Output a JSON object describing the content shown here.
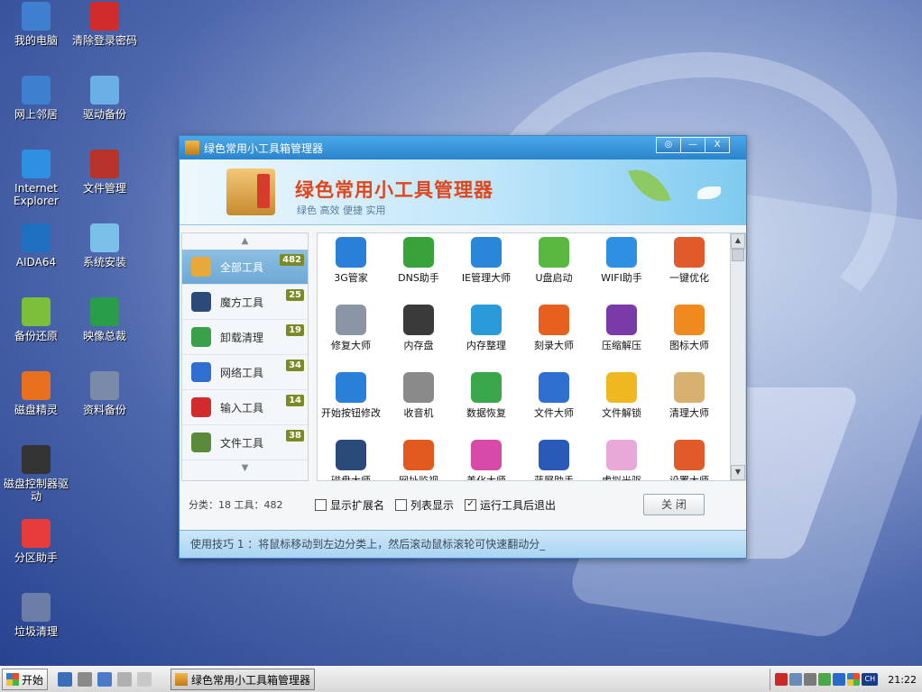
{
  "desktop": {
    "icons": [
      {
        "label": "我的电脑",
        "icon": "computer-icon",
        "color": "#3f7fd0"
      },
      {
        "label": "清除登录密码",
        "icon": "nt-key-icon",
        "color": "#d22b2b"
      },
      {
        "label": "网上邻居",
        "icon": "network-icon",
        "color": "#3f7fd0"
      },
      {
        "label": "驱动备份",
        "icon": "driver-backup-icon",
        "color": "#6ab0e6"
      },
      {
        "label": "Internet Explorer",
        "icon": "ie-icon",
        "color": "#2f8fe0"
      },
      {
        "label": "文件管理",
        "icon": "file-manager-icon",
        "color": "#b8342a"
      },
      {
        "label": "AIDA64",
        "icon": "aida64-icon",
        "color": "#1e6fc0"
      },
      {
        "label": "系统安装",
        "icon": "system-install-icon",
        "color": "#7bc0e8"
      },
      {
        "label": "备份还原",
        "icon": "backup-restore-icon",
        "color": "#7bbf3a"
      },
      {
        "label": "映像总裁",
        "icon": "image-president-icon",
        "color": "#2a9d4a"
      },
      {
        "label": "磁盘精灵",
        "icon": "diskgenius-icon",
        "color": "#e8701e"
      },
      {
        "label": "资料备份",
        "icon": "data-backup-icon",
        "color": "#7a8aa8"
      },
      {
        "label": "磁盘控制器驱动",
        "icon": "disk-controller-icon",
        "color": "#333333"
      },
      {
        "label": "分区助手",
        "icon": "partition-icon",
        "color": "#e83b3b"
      },
      {
        "label": "垃圾清理",
        "icon": "cleanup-icon",
        "color": "#6a7ea8"
      }
    ]
  },
  "window": {
    "title": "绿色常用小工具箱管理器",
    "buttons": {
      "help": "◎",
      "minimize": "—",
      "close": "X"
    },
    "banner": {
      "title": "绿色常用小工具管理器",
      "subtitle": "绿色 高效 便捷 实用"
    },
    "sidebar": {
      "up_arrow": "▲",
      "down_arrow": "▼",
      "categories": [
        {
          "label": "全部工具",
          "count": "482",
          "icon": "all-tools-icon",
          "color": "#e9a93a"
        },
        {
          "label": "魔方工具",
          "count": "25",
          "icon": "magic-cube-icon",
          "color": "#2b4a7a"
        },
        {
          "label": "卸载清理",
          "count": "19",
          "icon": "uninstall-icon",
          "color": "#3aa04a"
        },
        {
          "label": "网络工具",
          "count": "34",
          "icon": "globe-icon",
          "color": "#2f6fcf"
        },
        {
          "label": "输入工具",
          "count": "14",
          "icon": "input-icon",
          "color": "#d22b2b"
        },
        {
          "label": "文件工具",
          "count": "38",
          "icon": "file-tools-icon",
          "color": "#5a8a3a"
        }
      ]
    },
    "tools": [
      {
        "label": "3G管家",
        "icon": "3g-icon",
        "color": "#2a7fd8"
      },
      {
        "label": "DNS助手",
        "icon": "dns-icon",
        "color": "#3aa23a"
      },
      {
        "label": "IE管理大师",
        "icon": "ie-manager-icon",
        "color": "#2a86d8"
      },
      {
        "label": "U盘启动",
        "icon": "usb-boot-icon",
        "color": "#58b840"
      },
      {
        "label": "WIFI助手",
        "icon": "wifi-icon",
        "color": "#2f8fe0"
      },
      {
        "label": "一键优化",
        "icon": "rocket-icon",
        "color": "#e05a2a"
      },
      {
        "label": "修复大师",
        "icon": "wrench-icon",
        "color": "#8a96a6"
      },
      {
        "label": "内存盘",
        "icon": "ramdisk-icon",
        "color": "#3a3a3a"
      },
      {
        "label": "内存整理",
        "icon": "memory-icon",
        "color": "#2a9ad8"
      },
      {
        "label": "刻录大师",
        "icon": "burn-icon",
        "color": "#e8601e"
      },
      {
        "label": "压缩解压",
        "icon": "archive-icon",
        "color": "#7a3aa8"
      },
      {
        "label": "图标大师",
        "icon": "icon-master-icon",
        "color": "#f08a1e"
      },
      {
        "label": "开始按钮修改",
        "icon": "start-button-icon",
        "color": "#2a7fd8"
      },
      {
        "label": "收音机",
        "icon": "radio-icon",
        "color": "#8a8a8a"
      },
      {
        "label": "数据恢复",
        "icon": "data-recovery-icon",
        "color": "#3aa84a"
      },
      {
        "label": "文件大师",
        "icon": "folder-icon",
        "color": "#2f6fcf"
      },
      {
        "label": "文件解锁",
        "icon": "unlock-icon",
        "color": "#f0b820"
      },
      {
        "label": "清理大师",
        "icon": "broom-icon",
        "color": "#d8b070"
      },
      {
        "label": "磁盘大师",
        "icon": "disk-master-icon",
        "color": "#2a4a7a"
      },
      {
        "label": "网址监视",
        "icon": "url-monitor-icon",
        "color": "#e05a1e"
      },
      {
        "label": "美化大师",
        "icon": "brush-icon",
        "color": "#d84aa8"
      },
      {
        "label": "蓝屏助手",
        "icon": "bluescreen-icon",
        "color": "#2a5ab8"
      },
      {
        "label": "虚拟光驱",
        "icon": "virtual-cd-icon",
        "color": "#e8a8d8"
      },
      {
        "label": "设置大师",
        "icon": "rocket2-icon",
        "color": "#e05a2a"
      }
    ],
    "footer": {
      "stat": "分类：18  工具：482",
      "checkboxes": [
        {
          "label": "显示扩展名",
          "checked": false
        },
        {
          "label": "列表显示",
          "checked": false
        },
        {
          "label": "运行工具后退出",
          "checked": true
        }
      ],
      "close_label": "关 闭",
      "tip": "使用技巧 1 ：将鼠标移动到左边分类上，然后滚动鼠标滚轮可快速翻动分_"
    }
  },
  "taskbar": {
    "start_label": "开始",
    "task_label": "绿色常用小工具箱管理器",
    "clock": "21:22",
    "lang": "CH"
  }
}
